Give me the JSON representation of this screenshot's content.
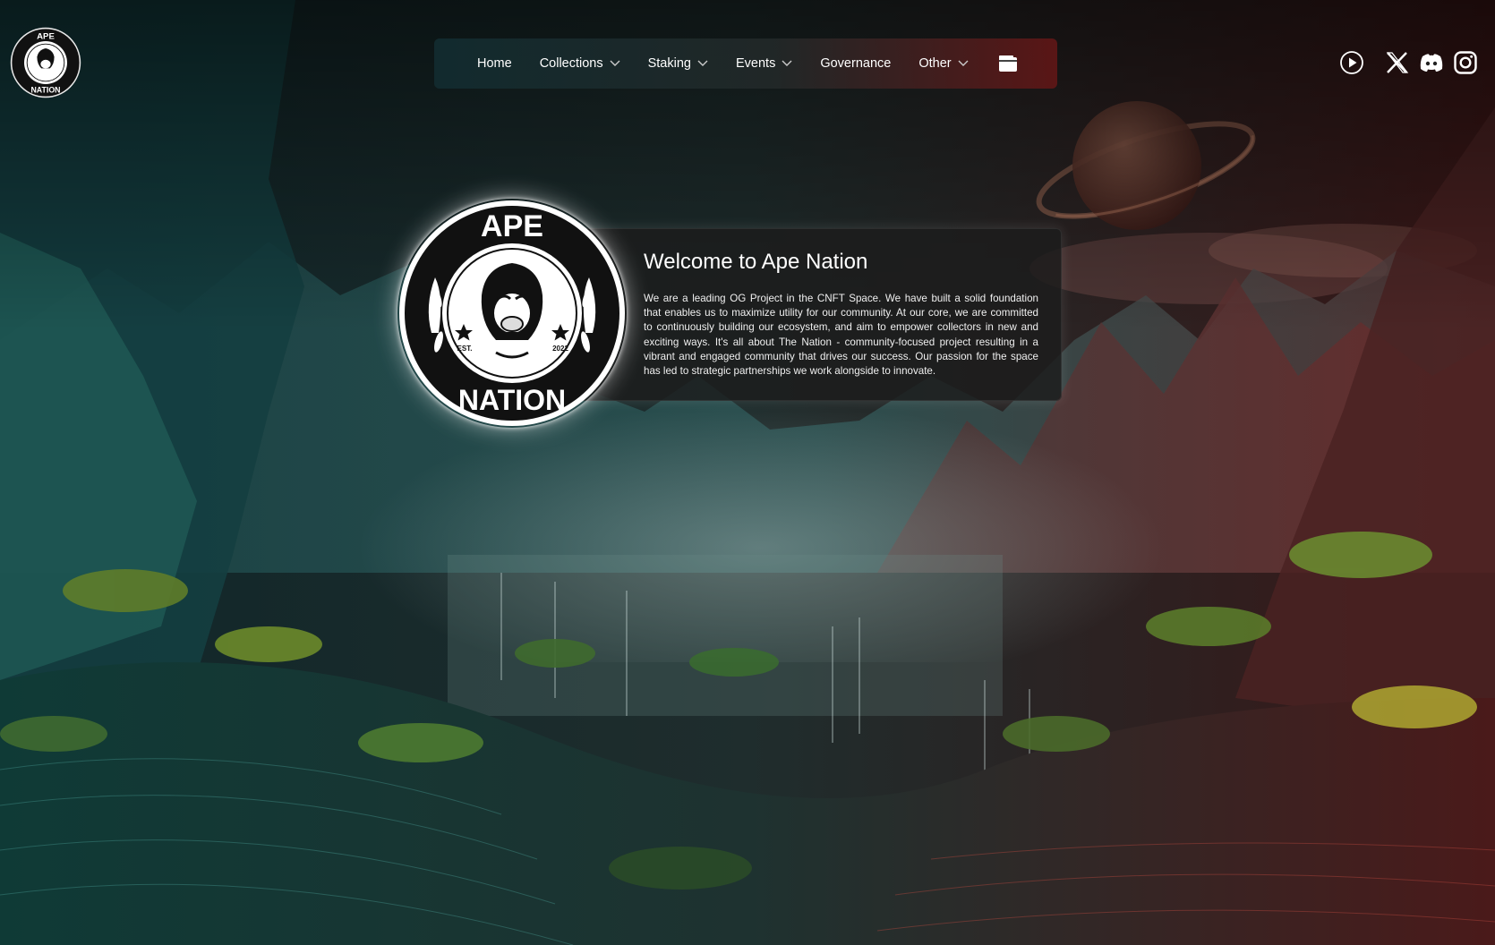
{
  "brand": {
    "logo_top": "APE",
    "logo_bottom": "NATION",
    "logo_left": "EST.",
    "logo_right": "2022"
  },
  "nav": {
    "items": [
      {
        "label": "Home",
        "has_dropdown": false
      },
      {
        "label": "Collections",
        "has_dropdown": true
      },
      {
        "label": "Staking",
        "has_dropdown": true
      },
      {
        "label": "Events",
        "has_dropdown": true
      },
      {
        "label": "Governance",
        "has_dropdown": false
      },
      {
        "label": "Other",
        "has_dropdown": true
      }
    ],
    "wallet_icon": "wallet-icon"
  },
  "social": [
    "play-icon",
    "x-icon",
    "discord-icon",
    "instagram-icon"
  ],
  "hero": {
    "title": "Welcome to Ape Nation",
    "body": "We are a leading OG Project in the CNFT Space. We have built a solid foundation that enables us to maximize utility for our community. At our core, we are committed to continuously building our ecosystem, and aim to empower collectors in new and exciting ways. It's all about The Nation - community-focused project resulting in a vibrant and engaged community that drives our success. Our passion for the space has led to strategic partnerships we work alongside to innovate."
  },
  "colors": {
    "teal_side": "#123b3e",
    "red_side": "#5a1e1e",
    "card_bg": "#1c1c1c"
  }
}
